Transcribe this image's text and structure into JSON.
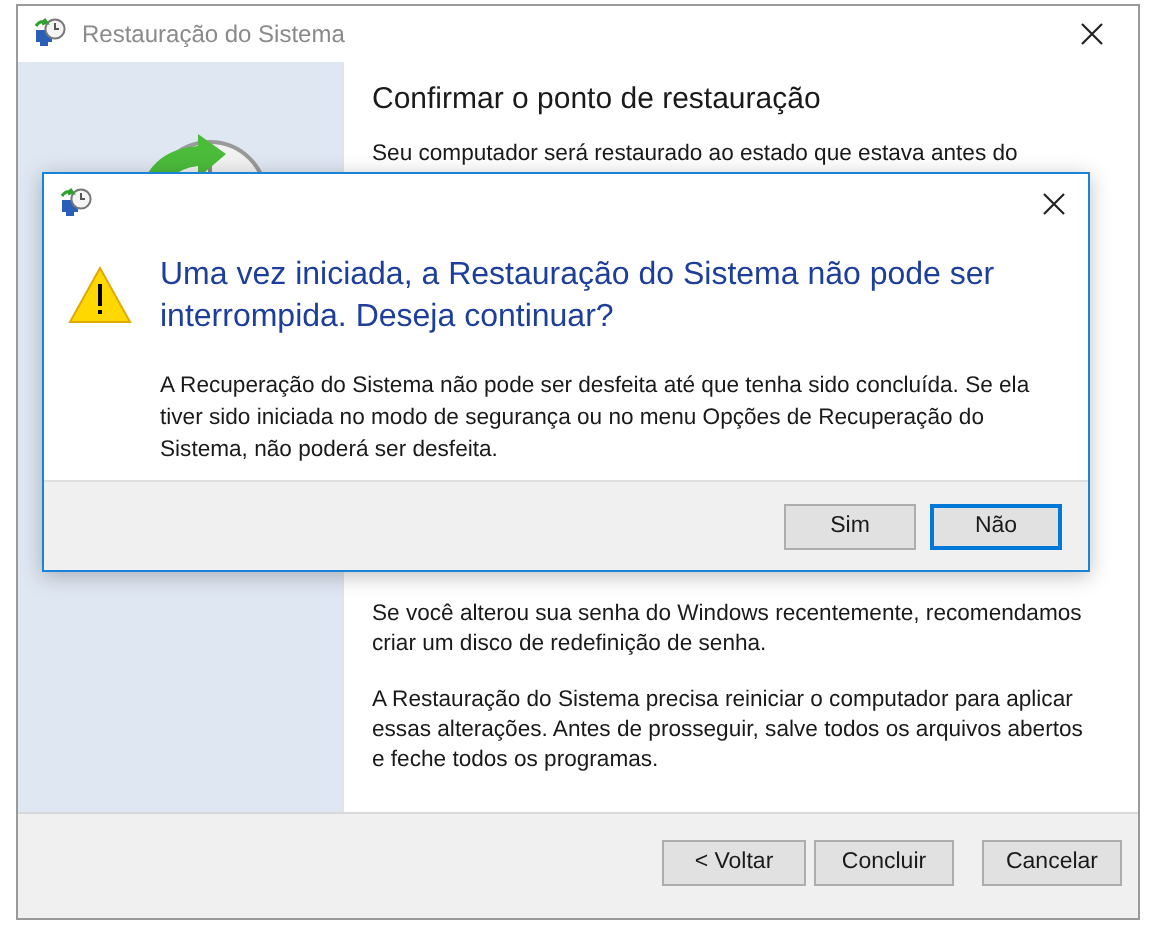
{
  "window": {
    "title": "Restauração do Sistema"
  },
  "page": {
    "heading": "Confirmar o ponto de restauração",
    "intro": "Seu computador será restaurado ao estado que estava antes do",
    "notes": [
      "Se você alterou sua senha do Windows recentemente, recomendamos criar um disco de redefinição de senha.",
      "A Restauração do Sistema precisa reiniciar o computador para aplicar essas alterações. Antes de prosseguir, salve todos os arquivos abertos e feche todos os programas."
    ]
  },
  "buttons": [
    {
      "label": "< Voltar",
      "default": false
    },
    {
      "label": "Concluir",
      "default": false
    },
    {
      "label": "Cancelar",
      "default": false
    }
  ],
  "dialog": {
    "heading": "Uma vez iniciada, a Restauração do Sistema não pode ser interrompida. Deseja continuar?",
    "message": "A Recuperação do Sistema não pode ser desfeita até que tenha sido concluída. Se ela tiver sido iniciada no modo de segurança ou no menu Opções de Recuperação do Sistema, não poderá ser desfeita.",
    "buttons": [
      {
        "label": "Sim",
        "default": false
      },
      {
        "label": "Não",
        "default": true
      }
    ]
  }
}
